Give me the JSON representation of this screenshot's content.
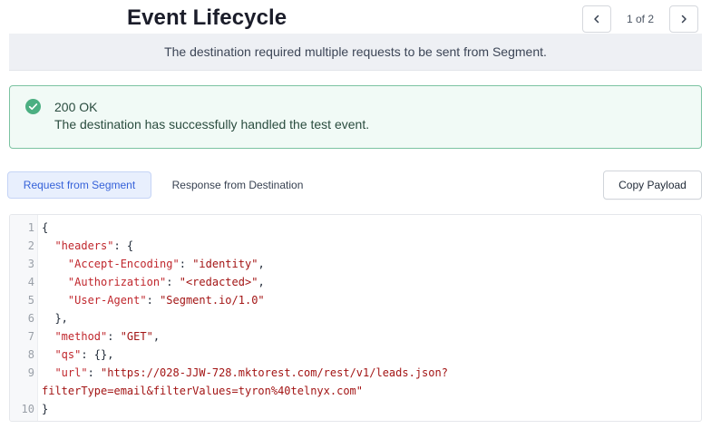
{
  "header": {
    "title": "Event Lifecycle",
    "pager": {
      "count": "1 of 2"
    }
  },
  "banner": {
    "text": "The destination required multiple requests to be sent from Segment."
  },
  "success": {
    "title": "200 OK",
    "message": "The destination has successfully handled the test event.",
    "icon": "check-circle-icon",
    "color": "#4caf82"
  },
  "tabs": [
    {
      "label": "Request from Segment",
      "active": true
    },
    {
      "label": "Response from Destination",
      "active": false
    }
  ],
  "copy_button": {
    "label": "Copy Payload"
  },
  "code": {
    "lines": [
      {
        "n": "1",
        "t": "{"
      },
      {
        "n": "2",
        "t": "  \"headers\": {"
      },
      {
        "n": "3",
        "t": "    \"Accept-Encoding\": \"identity\","
      },
      {
        "n": "4",
        "t": "    \"Authorization\": \"<redacted>\","
      },
      {
        "n": "5",
        "t": "    \"User-Agent\": \"Segment.io/1.0\""
      },
      {
        "n": "6",
        "t": "  },"
      },
      {
        "n": "7",
        "t": "  \"method\": \"GET\","
      },
      {
        "n": "8",
        "t": "  \"qs\": {},"
      },
      {
        "n": "9",
        "t": "  \"url\": \"https://028-JJW-728.mktorest.com/rest/v1/leads.json?"
      },
      {
        "n": "",
        "t": "filterType=email&filterValues=tyron%40telnyx.com\""
      },
      {
        "n": "10",
        "t": "}"
      }
    ]
  },
  "colors": {
    "accent": "#3662d9",
    "success_border": "#7cc3a2",
    "json_key": "#c0272d",
    "json_string": "#a31515"
  }
}
